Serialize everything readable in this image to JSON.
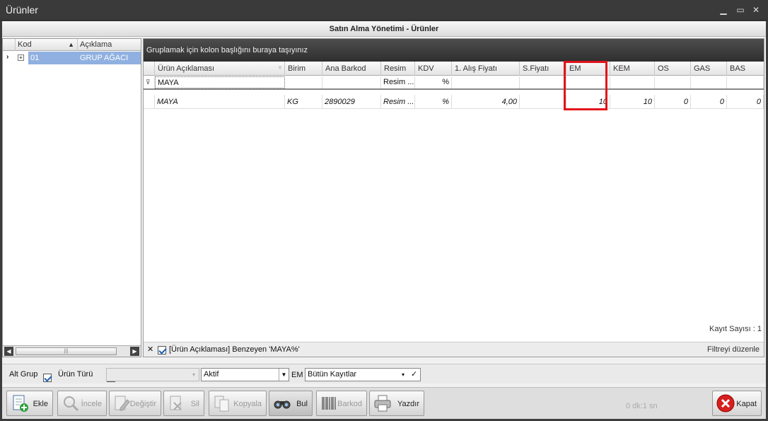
{
  "window": {
    "title": "Ürünler",
    "subtitle": "Satın Alma Yönetimi - Ürünler"
  },
  "tree": {
    "headers": [
      "Kod",
      "Açıklama"
    ],
    "rows": [
      {
        "kod": "01",
        "aciklama": "GRUP AĞACI"
      }
    ]
  },
  "grid": {
    "group_hint": "Gruplamak için kolon başlığını buraya taşıyınız",
    "columns": [
      "Ürün Açıklaması",
      "Birim",
      "Ana Barkod",
      "Resim",
      "KDV",
      "1. Alış Fiyatı",
      "S.Fiyatı",
      "EM",
      "KEM",
      "OS",
      "GAS",
      "BAS"
    ],
    "filter_row": {
      "urun": "MAYA",
      "resim": "Resim ...",
      "kdv": "%"
    },
    "rows": [
      {
        "urun": "MAYA",
        "birim": "KG",
        "barkod": "2890029",
        "resim": "Resim ...",
        "kdv": "%",
        "alis": "4,00",
        "sfiyat": "",
        "em": "10",
        "kem": "10",
        "os": "0",
        "gas": "0",
        "bas": "0"
      }
    ],
    "record_count": "Kayıt Sayısı : 1",
    "filter_text": "[Ürün Açıklaması] Benzeyen 'MAYA%'",
    "filter_edit": "Filtreyi düzenle"
  },
  "options": {
    "alt_grup": "Alt Grup",
    "urun_turu": "Ürün Türü",
    "status": "Aktif",
    "em_label": "EM",
    "records": "Bütün Kayıtlar"
  },
  "buttons": {
    "ekle": "Ekle",
    "incele": "İncele",
    "degistir": "Değiştir",
    "sil": "Sil",
    "kopyala": "Kopyala",
    "bul": "Bul",
    "barkod": "Barkod",
    "yazdir": "Yazdır",
    "kapat": "Kapat"
  },
  "timer": "0 dk:1 sn",
  "colors": {
    "highlight": "#e2141b",
    "selection": "#8fb0e0"
  }
}
